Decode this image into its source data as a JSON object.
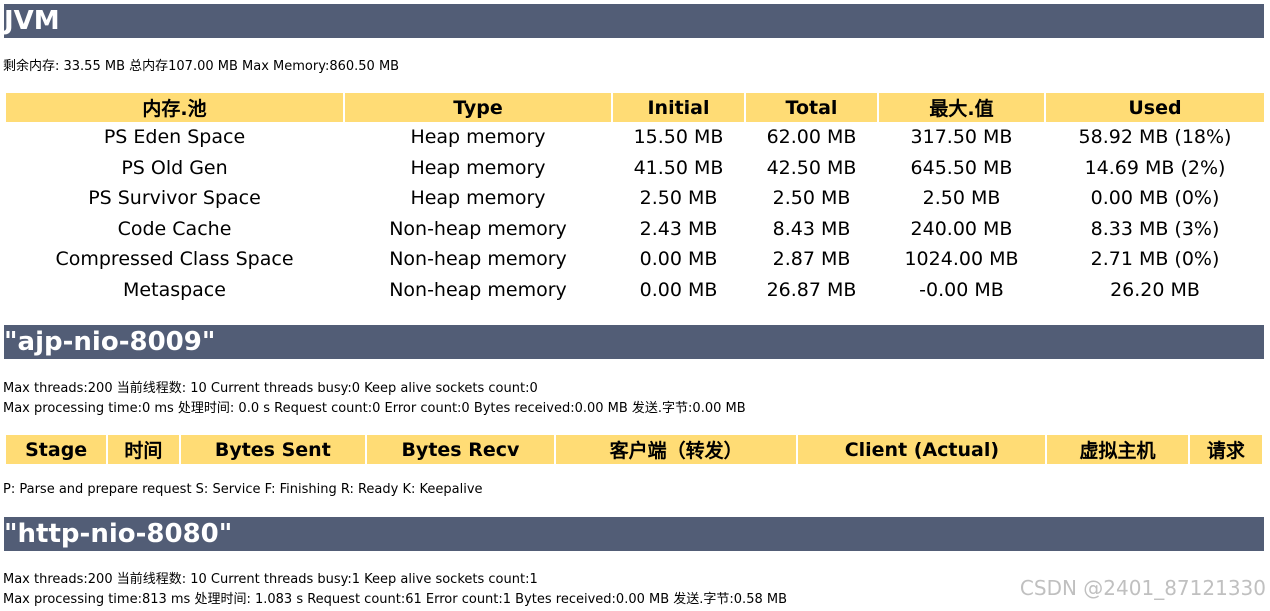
{
  "jvm": {
    "title": "JVM",
    "memory_summary": "剩余内存: 33.55 MB 总内存107.00 MB Max Memory:860.50 MB",
    "table": {
      "headers": [
        "内存.池",
        "Type",
        "Initial",
        "Total",
        "最大.值",
        "Used"
      ],
      "rows": [
        [
          "PS Eden Space",
          "Heap memory",
          "15.50 MB",
          "62.00 MB",
          "317.50 MB",
          "58.92 MB (18%)"
        ],
        [
          "PS Old Gen",
          "Heap memory",
          "41.50 MB",
          "42.50 MB",
          "645.50 MB",
          "14.69 MB (2%)"
        ],
        [
          "PS Survivor Space",
          "Heap memory",
          "2.50 MB",
          "2.50 MB",
          "2.50 MB",
          "0.00 MB (0%)"
        ],
        [
          "Code Cache",
          "Non-heap memory",
          "2.43 MB",
          "8.43 MB",
          "240.00 MB",
          "8.33 MB (3%)"
        ],
        [
          "Compressed Class Space",
          "Non-heap memory",
          "0.00 MB",
          "2.87 MB",
          "1024.00 MB",
          "2.71 MB (0%)"
        ],
        [
          "Metaspace",
          "Non-heap memory",
          "0.00 MB",
          "26.87 MB",
          "-0.00 MB",
          "26.20 MB"
        ]
      ]
    }
  },
  "ajp": {
    "title": "\"ajp-nio-8009\"",
    "line1": "Max threads:200 当前线程数: 10 Current threads busy:0 Keep alive sockets count:0",
    "line2": "Max processing time:0 ms 处理时间: 0.0 s Request count:0 Error count:0 Bytes received:0.00 MB 发送.字节:0.00 MB",
    "table": {
      "headers": [
        "Stage",
        "时间",
        "Bytes Sent",
        "Bytes Recv",
        "客户端（转发）",
        "Client (Actual)",
        "虚拟主机",
        "请求"
      ]
    },
    "legend": "P: Parse and prepare request S: Service F: Finishing R: Ready K: Keepalive"
  },
  "http": {
    "title": "\"http-nio-8080\"",
    "line1": "Max threads:200 当前线程数: 10 Current threads busy:1 Keep alive sockets count:1",
    "line2": "Max processing time:813 ms 处理时间: 1.083 s Request count:61 Error count:1 Bytes received:0.00 MB 发送.字节:0.58 MB"
  },
  "watermark": "CSDN @2401_87121330",
  "colors": {
    "section_header_bg": "#525d76",
    "table_header_bg": "#ffdc75"
  }
}
